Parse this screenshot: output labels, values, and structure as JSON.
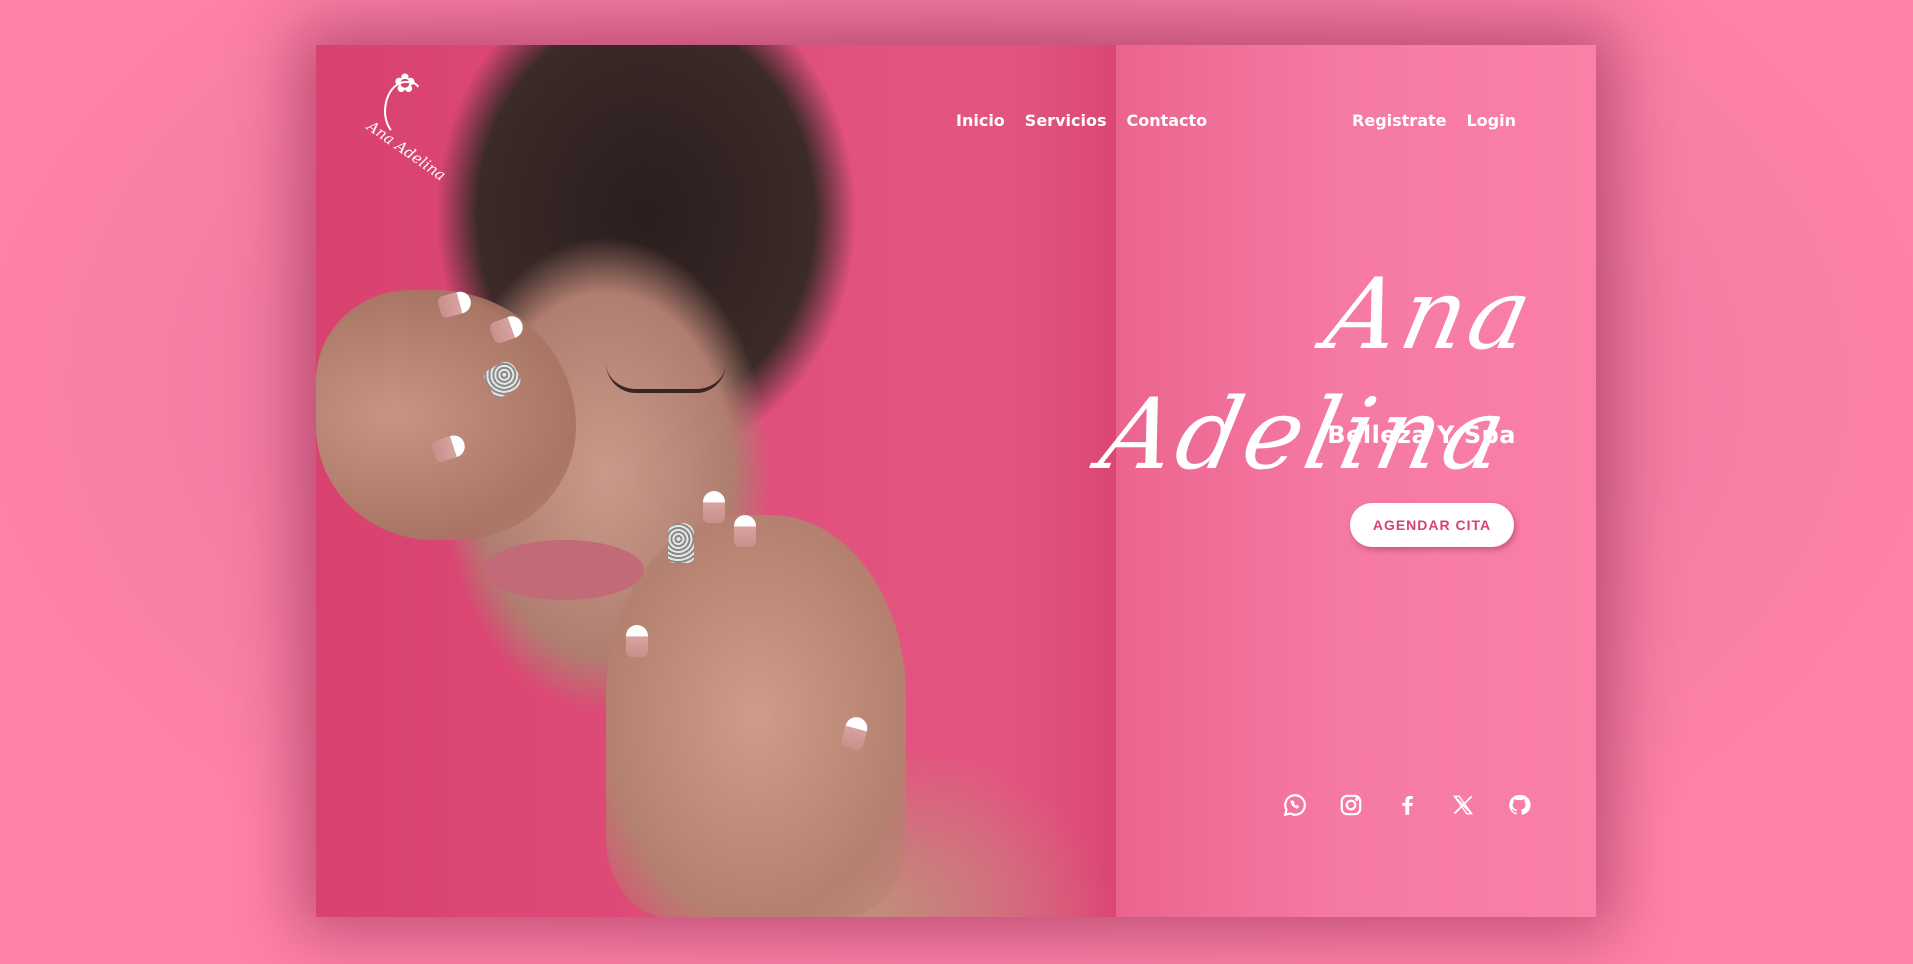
{
  "brand": {
    "logo_text": "Ana Adelina",
    "name": "Ana Adelina",
    "tagline": "Belleza Y Spa"
  },
  "nav": {
    "main": [
      {
        "label": "Inicio"
      },
      {
        "label": "Servicios"
      },
      {
        "label": "Contacto"
      }
    ],
    "auth": [
      {
        "label": "Registrate"
      },
      {
        "label": "Login"
      }
    ]
  },
  "hero": {
    "cta_label": "AGENDAR CITA"
  },
  "social": [
    {
      "icon": "whatsapp-icon"
    },
    {
      "icon": "instagram-icon"
    },
    {
      "icon": "facebook-icon"
    },
    {
      "icon": "x-twitter-icon"
    },
    {
      "icon": "github-icon"
    }
  ],
  "colors": {
    "page_background": "#ff7fa5",
    "card_gradient_start": "#d9416f",
    "card_gradient_end": "#fb80a7",
    "text": "#ffffff",
    "cta_text": "#d9416f"
  }
}
